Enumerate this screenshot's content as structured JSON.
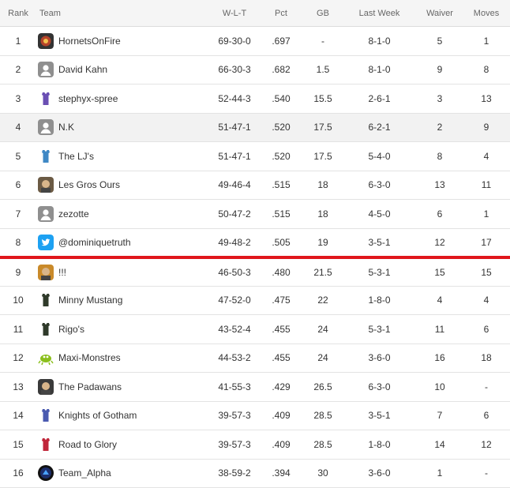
{
  "headers": {
    "rank": "Rank",
    "team": "Team",
    "wlt": "W-L-T",
    "pct": "Pct",
    "gb": "GB",
    "last_week": "Last Week",
    "waiver": "Waiver",
    "moves": "Moves"
  },
  "rows": [
    {
      "rank": "1",
      "team": "HornetsOnFire",
      "avatar": "hornet-logo-icon",
      "wlt": "69-30-0",
      "pct": ".697",
      "gb": "-",
      "last_week": "8-1-0",
      "waiver": "5",
      "moves": "1"
    },
    {
      "rank": "2",
      "team": "David Kahn",
      "avatar": "default-user-icon",
      "wlt": "66-30-3",
      "pct": ".682",
      "gb": "1.5",
      "last_week": "8-1-0",
      "waiver": "9",
      "moves": "8"
    },
    {
      "rank": "3",
      "team": "stephyx-spree",
      "avatar": "jersey-icon",
      "wlt": "52-44-3",
      "pct": ".540",
      "gb": "15.5",
      "last_week": "2-6-1",
      "waiver": "3",
      "moves": "13"
    },
    {
      "rank": "4",
      "team": "N.K",
      "avatar": "default-user-icon",
      "wlt": "51-47-1",
      "pct": ".520",
      "gb": "17.5",
      "last_week": "6-2-1",
      "waiver": "2",
      "moves": "9"
    },
    {
      "rank": "5",
      "team": "The LJ's",
      "avatar": "jersey-icon",
      "wlt": "51-47-1",
      "pct": ".520",
      "gb": "17.5",
      "last_week": "5-4-0",
      "waiver": "8",
      "moves": "4"
    },
    {
      "rank": "6",
      "team": "Les Gros Ours",
      "avatar": "photo-avatar-icon",
      "wlt": "49-46-4",
      "pct": ".515",
      "gb": "18",
      "last_week": "6-3-0",
      "waiver": "13",
      "moves": "11"
    },
    {
      "rank": "7",
      "team": "zezotte",
      "avatar": "default-user-icon",
      "wlt": "50-47-2",
      "pct": ".515",
      "gb": "18",
      "last_week": "4-5-0",
      "waiver": "6",
      "moves": "1"
    },
    {
      "rank": "8",
      "team": "@dominiquetruth",
      "avatar": "twitter-bird-icon",
      "wlt": "49-48-2",
      "pct": ".505",
      "gb": "19",
      "last_week": "3-5-1",
      "waiver": "12",
      "moves": "17"
    },
    {
      "rank": "9",
      "team": "!!!",
      "avatar": "photo-avatar-icon",
      "wlt": "46-50-3",
      "pct": ".480",
      "gb": "21.5",
      "last_week": "5-3-1",
      "waiver": "15",
      "moves": "15"
    },
    {
      "rank": "10",
      "team": "Minny Mustang",
      "avatar": "jersey-icon",
      "wlt": "47-52-0",
      "pct": ".475",
      "gb": "22",
      "last_week": "1-8-0",
      "waiver": "4",
      "moves": "4"
    },
    {
      "rank": "11",
      "team": "Rigo's",
      "avatar": "jersey-icon",
      "wlt": "43-52-4",
      "pct": ".455",
      "gb": "24",
      "last_week": "5-3-1",
      "waiver": "11",
      "moves": "6"
    },
    {
      "rank": "12",
      "team": "Maxi-Monstres",
      "avatar": "monster-icon",
      "wlt": "44-53-2",
      "pct": ".455",
      "gb": "24",
      "last_week": "3-6-0",
      "waiver": "16",
      "moves": "18"
    },
    {
      "rank": "13",
      "team": "The Padawans",
      "avatar": "photo-avatar-icon",
      "wlt": "41-55-3",
      "pct": ".429",
      "gb": "26.5",
      "last_week": "6-3-0",
      "waiver": "10",
      "moves": "-"
    },
    {
      "rank": "14",
      "team": "Knights of Gotham",
      "avatar": "jersey-icon",
      "wlt": "39-57-3",
      "pct": ".409",
      "gb": "28.5",
      "last_week": "3-5-1",
      "waiver": "7",
      "moves": "6"
    },
    {
      "rank": "15",
      "team": "Road to Glory",
      "avatar": "jersey-icon",
      "wlt": "39-57-3",
      "pct": ".409",
      "gb": "28.5",
      "last_week": "1-8-0",
      "waiver": "14",
      "moves": "12"
    },
    {
      "rank": "16",
      "team": "Team_Alpha",
      "avatar": "team-alpha-logo-icon",
      "wlt": "38-59-2",
      "pct": ".394",
      "gb": "30",
      "last_week": "3-6-0",
      "waiver": "1",
      "moves": "-"
    }
  ],
  "avatar_colors": [
    "#b5442a",
    "#8f8f8f",
    "#6a4fb3",
    "#8f8f8f",
    "#3f88c5",
    "#6b5a44",
    "#8f8f8f",
    "#1da1f2",
    "#c98a2a",
    "#2f3a2a",
    "#2f3a2a",
    "#8bbf1d",
    "#3a3a3a",
    "#4a5ab0",
    "#c0263a",
    "#1c2d6b"
  ],
  "highlight_row": 3,
  "cutoff_after_row": 7,
  "colors": {
    "cutoff_line": "#e0161b",
    "highlight_bg": "#f2f2f2",
    "header_bg": "#f5f5f5"
  }
}
